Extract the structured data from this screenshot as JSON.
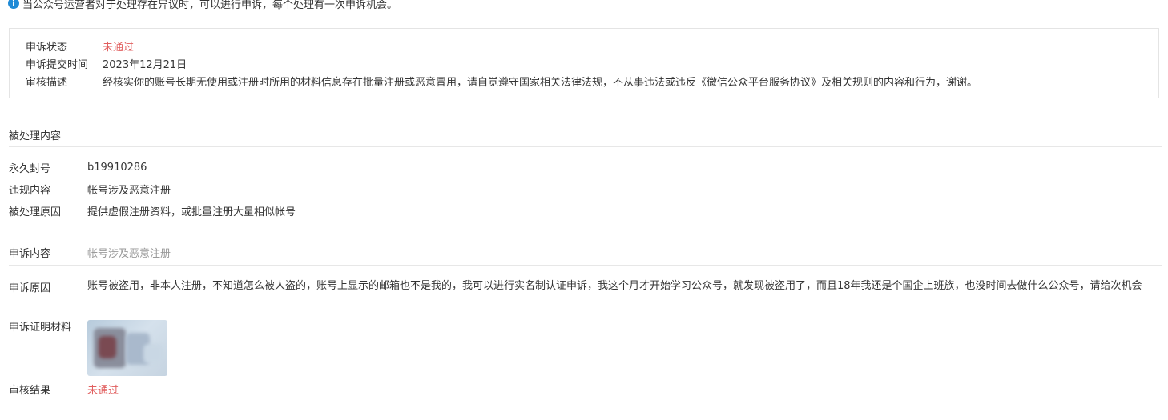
{
  "notice": {
    "icon": "info-icon",
    "text": "当公众号运营者对于处理存在异议时，可以进行申诉，每个处理有一次申诉机会。"
  },
  "appeal_status": {
    "status_label": "申诉状态",
    "status_value": "未通过",
    "submit_time_label": "申诉提交时间",
    "submit_time_value": "2023年12月21日",
    "review_desc_label": "审核描述",
    "review_desc_value": "经核实你的账号长期无使用或注册时所用的材料信息存在批量注册或恶意冒用，请自觉遵守国家相关法律法规，不从事违法或违反《微信公众平台服务协议》及相关规则的内容和行为，谢谢。"
  },
  "processed": {
    "section_title": "被处理内容",
    "ban_label": "永久封号",
    "ban_value": "b19910286",
    "violation_label": "违规内容",
    "violation_value": "帐号涉及恶意注册",
    "reason_label": "被处理原因",
    "reason_value": "提供虚假注册资料，或批量注册大量相似帐号"
  },
  "appeal": {
    "content_label": "申诉内容",
    "content_value": "帐号涉及恶意注册",
    "reason_label": "申诉原因",
    "reason_value": "账号被盗用，非本人注册，不知道怎么被人盗的，账号上显示的邮箱也不是我的，我可以进行实名制认证申诉，我这个月才开始学习公众号，就发现被盗用了，而且18年我还是个国企上班族，也没时间去做什么公众号，请给次机会",
    "evidence_label": "申诉证明材料",
    "result_label": "审核结果",
    "result_value": "未通过"
  },
  "colors": {
    "fail_red": "#e15f5f",
    "info_blue": "#1e8ad6",
    "muted_gray": "#9a9a9a"
  }
}
